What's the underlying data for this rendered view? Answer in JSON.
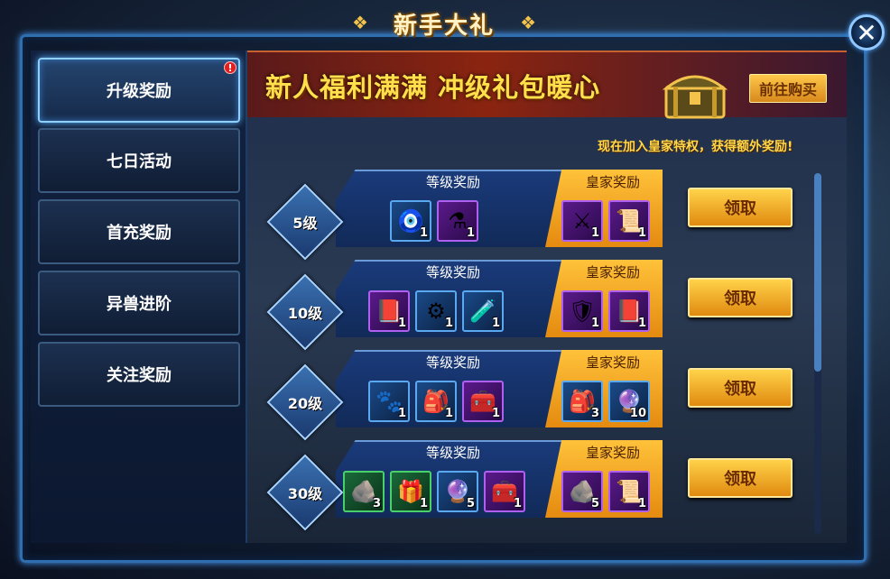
{
  "title": "新手大礼",
  "close_label": "✕",
  "sidebar": {
    "items": [
      {
        "label": "升级奖励",
        "active": true,
        "badge": "!"
      },
      {
        "label": "七日活动",
        "active": false
      },
      {
        "label": "首充奖励",
        "active": false
      },
      {
        "label": "异兽进阶",
        "active": false
      },
      {
        "label": "关注奖励",
        "active": false
      }
    ]
  },
  "banner": {
    "headline": "新人福利满满  冲级礼包暖心",
    "buy_label": "前往购买",
    "royal_note": "现在加入皇家特权，获得额外奖励!"
  },
  "headers": {
    "reward": "等级奖励",
    "royal": "皇家奖励"
  },
  "claim_label": "领取",
  "rows": [
    {
      "level": "5级",
      "rewards": [
        {
          "icon": "amulet-icon",
          "glyph": "🧿",
          "count": "1",
          "tier": "blue"
        },
        {
          "icon": "potion-icon",
          "glyph": "⚗",
          "count": "1",
          "tier": "purple"
        }
      ],
      "royal": [
        {
          "icon": "weapon-icon",
          "glyph": "⚔",
          "count": "1",
          "tier": "purple"
        },
        {
          "icon": "scroll-icon",
          "glyph": "📜",
          "count": "1",
          "tier": "purple"
        }
      ]
    },
    {
      "level": "10级",
      "rewards": [
        {
          "icon": "book-icon",
          "glyph": "📕",
          "count": "1",
          "tier": "purple"
        },
        {
          "icon": "gear-icon",
          "glyph": "⚙",
          "count": "1",
          "tier": "blue"
        },
        {
          "icon": "flask-icon",
          "glyph": "🧪",
          "count": "1",
          "tier": "blue"
        }
      ],
      "royal": [
        {
          "icon": "armor-icon",
          "glyph": "🛡",
          "count": "1",
          "tier": "purple"
        },
        {
          "icon": "book-icon",
          "glyph": "📕",
          "count": "1",
          "tier": "purple"
        }
      ]
    },
    {
      "level": "20级",
      "rewards": [
        {
          "icon": "pet-token-icon",
          "glyph": "🐾",
          "count": "1",
          "tier": "blue"
        },
        {
          "icon": "bag-icon",
          "glyph": "🎒",
          "count": "1",
          "tier": "blue"
        },
        {
          "icon": "chest-icon",
          "glyph": "🧰",
          "count": "1",
          "tier": "purple"
        }
      ],
      "royal": [
        {
          "icon": "bag-icon",
          "glyph": "🎒",
          "count": "3",
          "tier": "blue"
        },
        {
          "icon": "orb-icon",
          "glyph": "🔮",
          "count": "10",
          "tier": "blue"
        }
      ]
    },
    {
      "level": "30级",
      "rewards": [
        {
          "icon": "rune-stone-icon",
          "glyph": "🪨",
          "count": "3",
          "tier": "green"
        },
        {
          "icon": "treasure-chest-icon",
          "glyph": "🎁",
          "count": "1",
          "tier": "green"
        },
        {
          "icon": "orb-icon",
          "glyph": "🔮",
          "count": "5",
          "tier": "blue"
        },
        {
          "icon": "chest-icon",
          "glyph": "🧰",
          "count": "1",
          "tier": "purple"
        }
      ],
      "royal": [
        {
          "icon": "rune-stone-icon",
          "glyph": "🪨",
          "count": "5",
          "tier": "purple"
        },
        {
          "icon": "scroll-icon",
          "glyph": "📜",
          "count": "1",
          "tier": "purple"
        }
      ]
    }
  ],
  "colors": {
    "accent_gold": "#ffd24a",
    "frame_blue": "#2f6fb0",
    "banner_red": "#8a2410"
  }
}
